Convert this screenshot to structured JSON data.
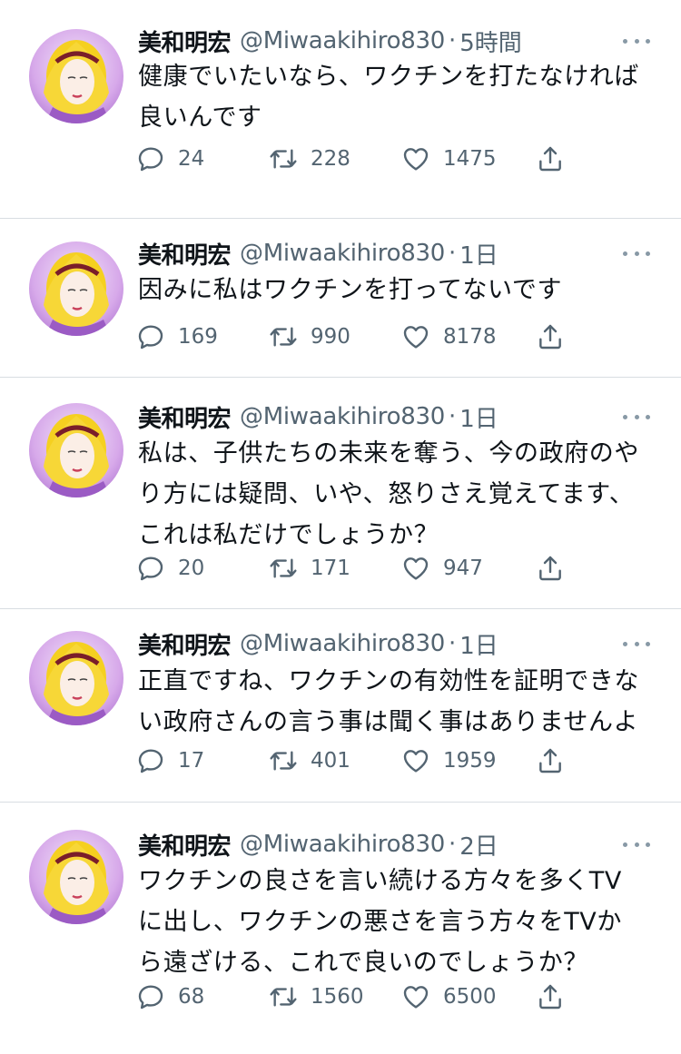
{
  "tweets": [
    {
      "name": "美和明宏",
      "handle": "@Miwaakihiro830",
      "sep": "·",
      "time": "5時間",
      "text": "健康でいたいなら、ワクチンを打たなければ\n良いんです",
      "replies": "24",
      "retweets": "228",
      "likes": "1475"
    },
    {
      "name": "美和明宏",
      "handle": "@Miwaakihiro830",
      "sep": "·",
      "time": "1日",
      "text": "因みに私はワクチンを打ってないです",
      "replies": "169",
      "retweets": "990",
      "likes": "8178"
    },
    {
      "name": "美和明宏",
      "handle": "@Miwaakihiro830",
      "sep": "·",
      "time": "1日",
      "text": "私は、子供たちの未来を奪う、今の政府のや\nり方には疑問、いや、怒りさえ覚えてます、\nこれは私だけでしょうか？",
      "replies": "20",
      "retweets": "171",
      "likes": "947"
    },
    {
      "name": "美和明宏",
      "handle": "@Miwaakihiro830",
      "sep": "·",
      "time": "1日",
      "text": "正直ですね、ワクチンの有効性を証明できな\nい政府さんの言う事は聞く事はありませんよ",
      "replies": "17",
      "retweets": "401",
      "likes": "1959"
    },
    {
      "name": "美和明宏",
      "handle": "@Miwaakihiro830",
      "sep": "·",
      "time": "2日",
      "text": "ワクチンの良さを言い続ける方々を多くTV\nに出し、ワクチンの悪さを言う方々をTVか\nら遠ざける、これで良いのでしょうか？",
      "replies": "68",
      "retweets": "1560",
      "likes": "6500"
    }
  ],
  "icons": {
    "reply": "reply-icon",
    "retweet": "retweet-icon",
    "like": "like-icon",
    "share": "share-icon",
    "more": "more-icon"
  },
  "colors": {
    "text": "#0f1419",
    "secondary": "#536471",
    "divider": "#d8dde2",
    "icon": "#536471"
  }
}
